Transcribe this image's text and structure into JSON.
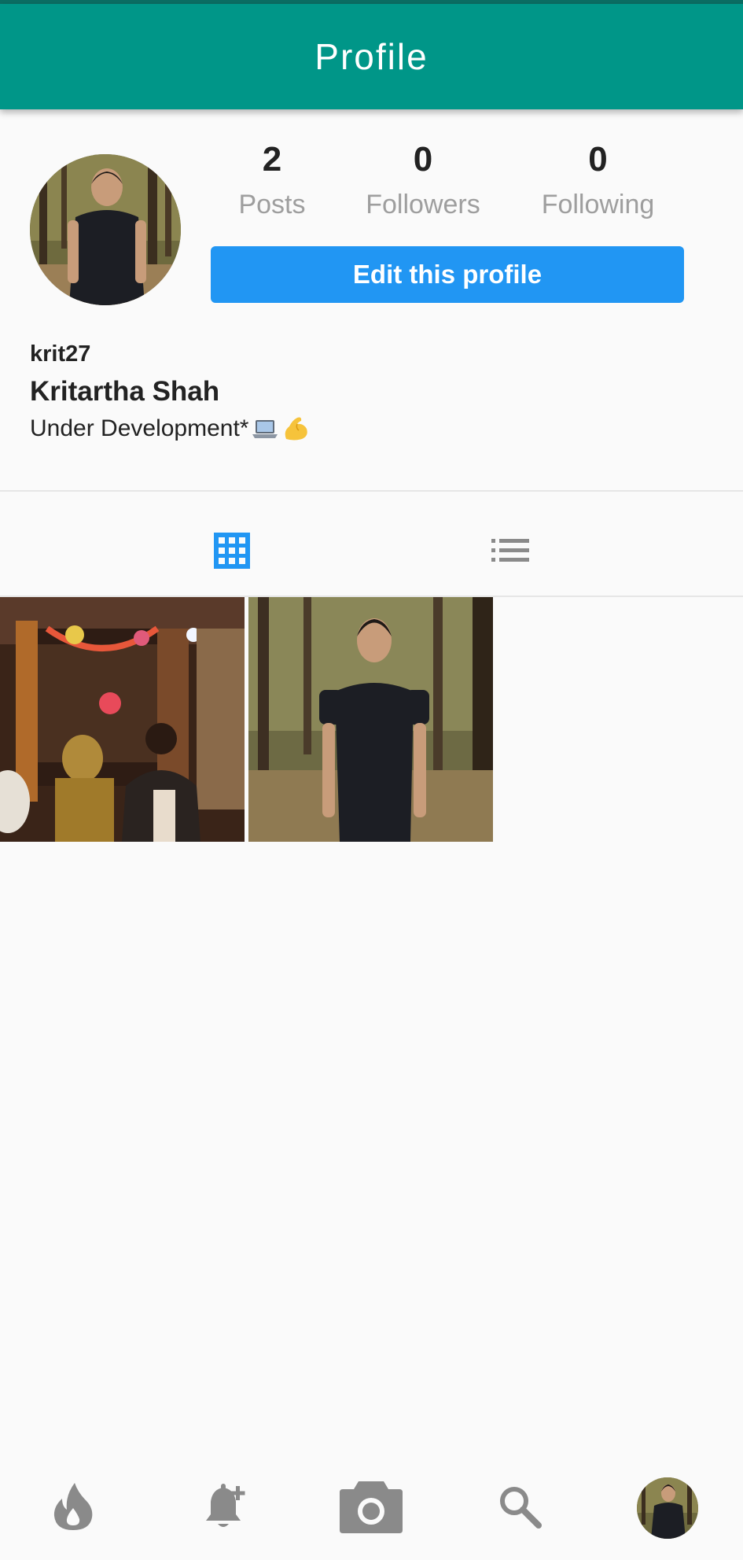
{
  "appbar": {
    "title": "Profile"
  },
  "profile": {
    "username": "krit27",
    "full_name": "Kritartha Shah",
    "bio": "Under Development*",
    "bio_emojis": [
      "laptop-emoji",
      "flexed-biceps-emoji"
    ]
  },
  "stats": [
    {
      "count": "2",
      "label": "Posts"
    },
    {
      "count": "0",
      "label": "Followers"
    },
    {
      "count": "0",
      "label": "Following"
    }
  ],
  "edit_button": {
    "label": "Edit this profile"
  },
  "tabs": [
    {
      "icon": "grid-icon",
      "active": true
    },
    {
      "icon": "list-icon",
      "active": false
    }
  ],
  "posts": [
    {
      "image": "temple-crowd-photo"
    },
    {
      "image": "man-in-forest-photo"
    }
  ],
  "bottom_nav": [
    {
      "icon": "flame-icon"
    },
    {
      "icon": "bell-plus-icon"
    },
    {
      "icon": "camera-icon"
    },
    {
      "icon": "search-icon"
    },
    {
      "icon": "profile-avatar"
    }
  ],
  "colors": {
    "appbar": "#009688",
    "accent": "#2196f3",
    "muted": "#9e9e9e",
    "nav_icon": "#8a8a8a"
  }
}
